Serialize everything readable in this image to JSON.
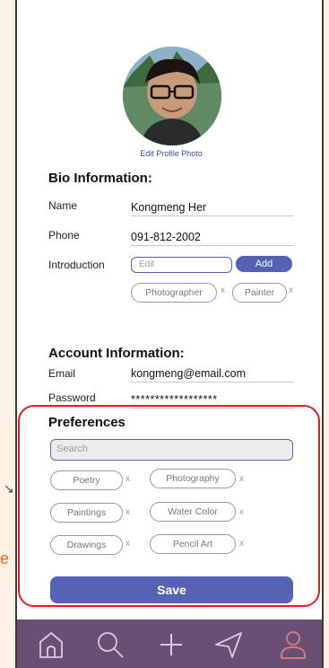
{
  "profile": {
    "edit_photo_label": "Edit Profile Photo"
  },
  "bio": {
    "title": "Bio Information:",
    "name_label": "Name",
    "name_value": "Kongmeng Her",
    "phone_label": "Phone",
    "phone_value": "091-812-2002",
    "intro_label": "Introduction",
    "intro_placeholder": "Edit",
    "add_label": "Add",
    "tags": [
      "Photographer",
      "Painter"
    ]
  },
  "account": {
    "title": "Account Information:",
    "email_label": "Email",
    "email_value": "kongmeng@email.com",
    "password_label": "Password",
    "password_value": "******************"
  },
  "preferences": {
    "title": "Preferences",
    "search_placeholder": "Search",
    "chips": [
      "Poetry",
      "Photography",
      "Paintings",
      "Water Color",
      "Drawings",
      "Pencil Art"
    ],
    "remove_glyph": "x"
  },
  "save_label": "Save",
  "side_fragment": "e",
  "nav": [
    "home-icon",
    "search-icon",
    "plus-icon",
    "send-icon",
    "profile-icon"
  ],
  "colors": {
    "accent": "#5462b4",
    "nav_bg": "#6a4f75",
    "highlight": "#e41d23",
    "active_nav": "#e07b7b"
  }
}
